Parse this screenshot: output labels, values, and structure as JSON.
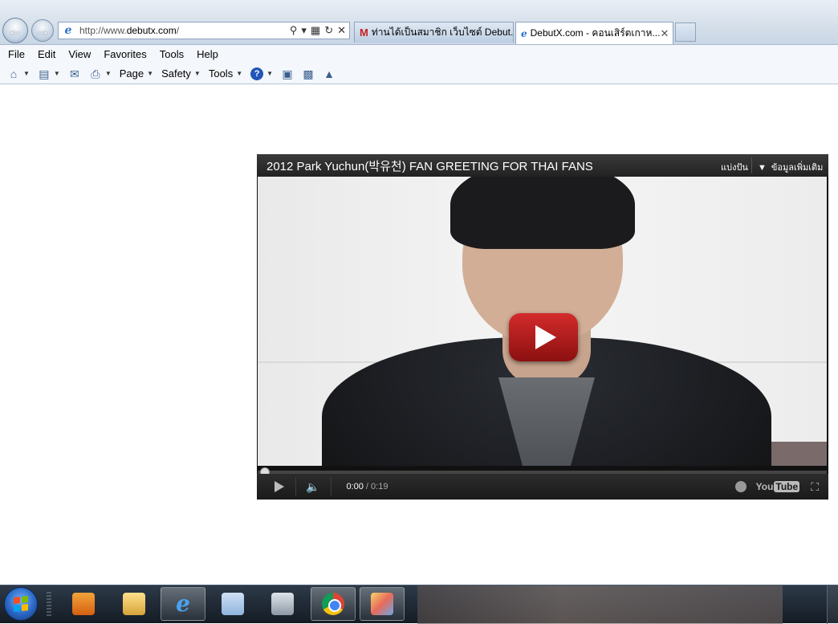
{
  "browser": {
    "address": {
      "url_prefix": "http://www.",
      "url_domain": "debutx.com",
      "url_suffix": "/",
      "search_icon": "search-icon",
      "refresh_icon": "refresh-icon",
      "stop_icon": "close-icon"
    },
    "tabs": [
      {
        "label": "ท่านได้เป็นสมาชิก เว็บไซต์ Debut...",
        "icon": "gmail-icon",
        "active": false
      },
      {
        "label": "DebutX.com - คอนเสิร์ตเกาห...",
        "icon": "ie-icon",
        "active": true,
        "close": "✕"
      }
    ],
    "menu": [
      "File",
      "Edit",
      "View",
      "Favorites",
      "Tools",
      "Help"
    ],
    "commands": {
      "page": "Page",
      "safety": "Safety",
      "tools": "Tools"
    }
  },
  "video": {
    "title": "2012 Park Yuchun(박유천) FAN GREETING FOR THAI FANS",
    "share": "แบ่งปัน",
    "more_info": "ข้อมูลเพิ่มเติม",
    "time_current": "0:00",
    "time_separator": " / ",
    "time_total": "0:19",
    "progress": 0,
    "brand_you": "You",
    "brand_tube": "Tube",
    "accent_color": "#c91c1c"
  },
  "taskbar": {
    "items": [
      {
        "name": "media-player-icon",
        "open": false
      },
      {
        "name": "folder-icon",
        "open": false
      },
      {
        "name": "internet-explorer-icon",
        "open": true
      },
      {
        "name": "cards-icon",
        "open": false
      },
      {
        "name": "settings-tool-icon",
        "open": false
      },
      {
        "name": "chrome-icon",
        "open": true
      },
      {
        "name": "paint-icon",
        "open": true
      }
    ]
  }
}
